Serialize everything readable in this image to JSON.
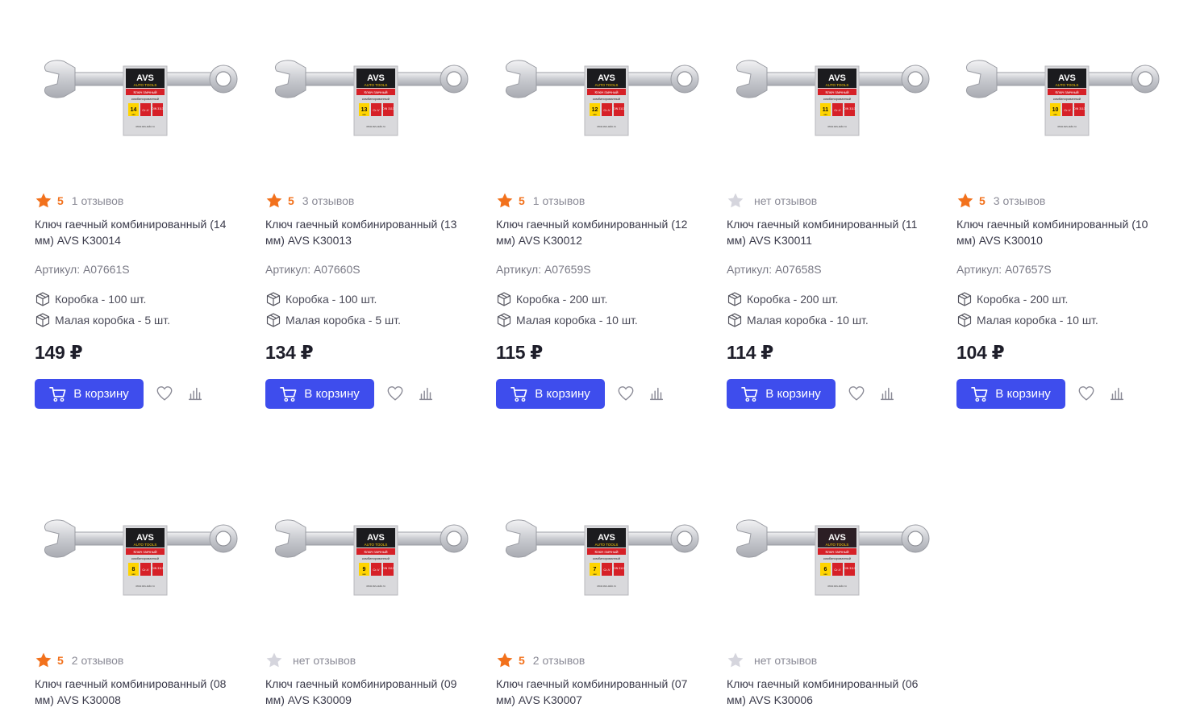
{
  "colors": {
    "accent": "#3e4ded",
    "star_active": "#f2711c",
    "star_inactive": "#d5d5dd"
  },
  "products": [
    {
      "rating": 5,
      "reviews": "1 отзывов",
      "title": "Ключ гаечный комбинированный (14 мм) AVS K30014",
      "sku": "Артикул: A07661S",
      "pack1": "Коробка - 100 шт.",
      "pack2": "Малая коробка - 5 шт.",
      "price": "149 ₽",
      "size": "14",
      "buy": "В корзину"
    },
    {
      "rating": 5,
      "reviews": "3 отзывов",
      "title": "Ключ гаечный комбинированный (13 мм) AVS K30013",
      "sku": "Артикул: A07660S",
      "pack1": "Коробка - 100 шт.",
      "pack2": "Малая коробка - 5 шт.",
      "price": "134 ₽",
      "size": "13",
      "buy": "В корзину"
    },
    {
      "rating": 5,
      "reviews": "1 отзывов",
      "title": "Ключ гаечный комбинированный (12 мм) AVS K30012",
      "sku": "Артикул: A07659S",
      "pack1": "Коробка - 200 шт.",
      "pack2": "Малая коробка - 10 шт.",
      "price": "115 ₽",
      "size": "12",
      "buy": "В корзину"
    },
    {
      "rating": null,
      "reviews": "нет отзывов",
      "title": "Ключ гаечный комбинированный (11 мм) AVS K30011",
      "sku": "Артикул: A07658S",
      "pack1": "Коробка - 200 шт.",
      "pack2": "Малая коробка - 10 шт.",
      "price": "114 ₽",
      "size": "11",
      "buy": "В корзину"
    },
    {
      "rating": 5,
      "reviews": "3 отзывов",
      "title": "Ключ гаечный комбинированный (10 мм) AVS K30010",
      "sku": "Артикул: A07657S",
      "pack1": "Коробка - 200 шт.",
      "pack2": "Малая коробка - 10 шт.",
      "price": "104 ₽",
      "size": "10",
      "buy": "В корзину"
    },
    {
      "rating": 5,
      "reviews": "2 отзывов",
      "title": "Ключ гаечный комбинированный (08 мм) AVS K30008",
      "size": "8"
    },
    {
      "rating": null,
      "reviews": "нет отзывов",
      "title": "Ключ гаечный комбинированный (09 мм) AVS K30009",
      "size": "9"
    },
    {
      "rating": 5,
      "reviews": "2 отзывов",
      "title": "Ключ гаечный комбинированный (07 мм) AVS K30007",
      "size": "7"
    },
    {
      "rating": null,
      "reviews": "нет отзывов",
      "title": "Ключ гаечный комбинированный (06 мм) AVS K30006",
      "size": "6"
    }
  ],
  "label": {
    "brand": "AVS",
    "sub": "AUTO TOOLS",
    "line1": "Ключ гаечный",
    "line2": "комбинированный",
    "steel": "Cr-V",
    "din": "DIN 3113",
    "unit": "мм",
    "site": "www.avs-auto.ru"
  },
  "icons": {
    "star": "star-icon",
    "box": "box-icon",
    "cart": "cart-icon",
    "heart": "heart-icon",
    "compare": "compare-icon"
  }
}
